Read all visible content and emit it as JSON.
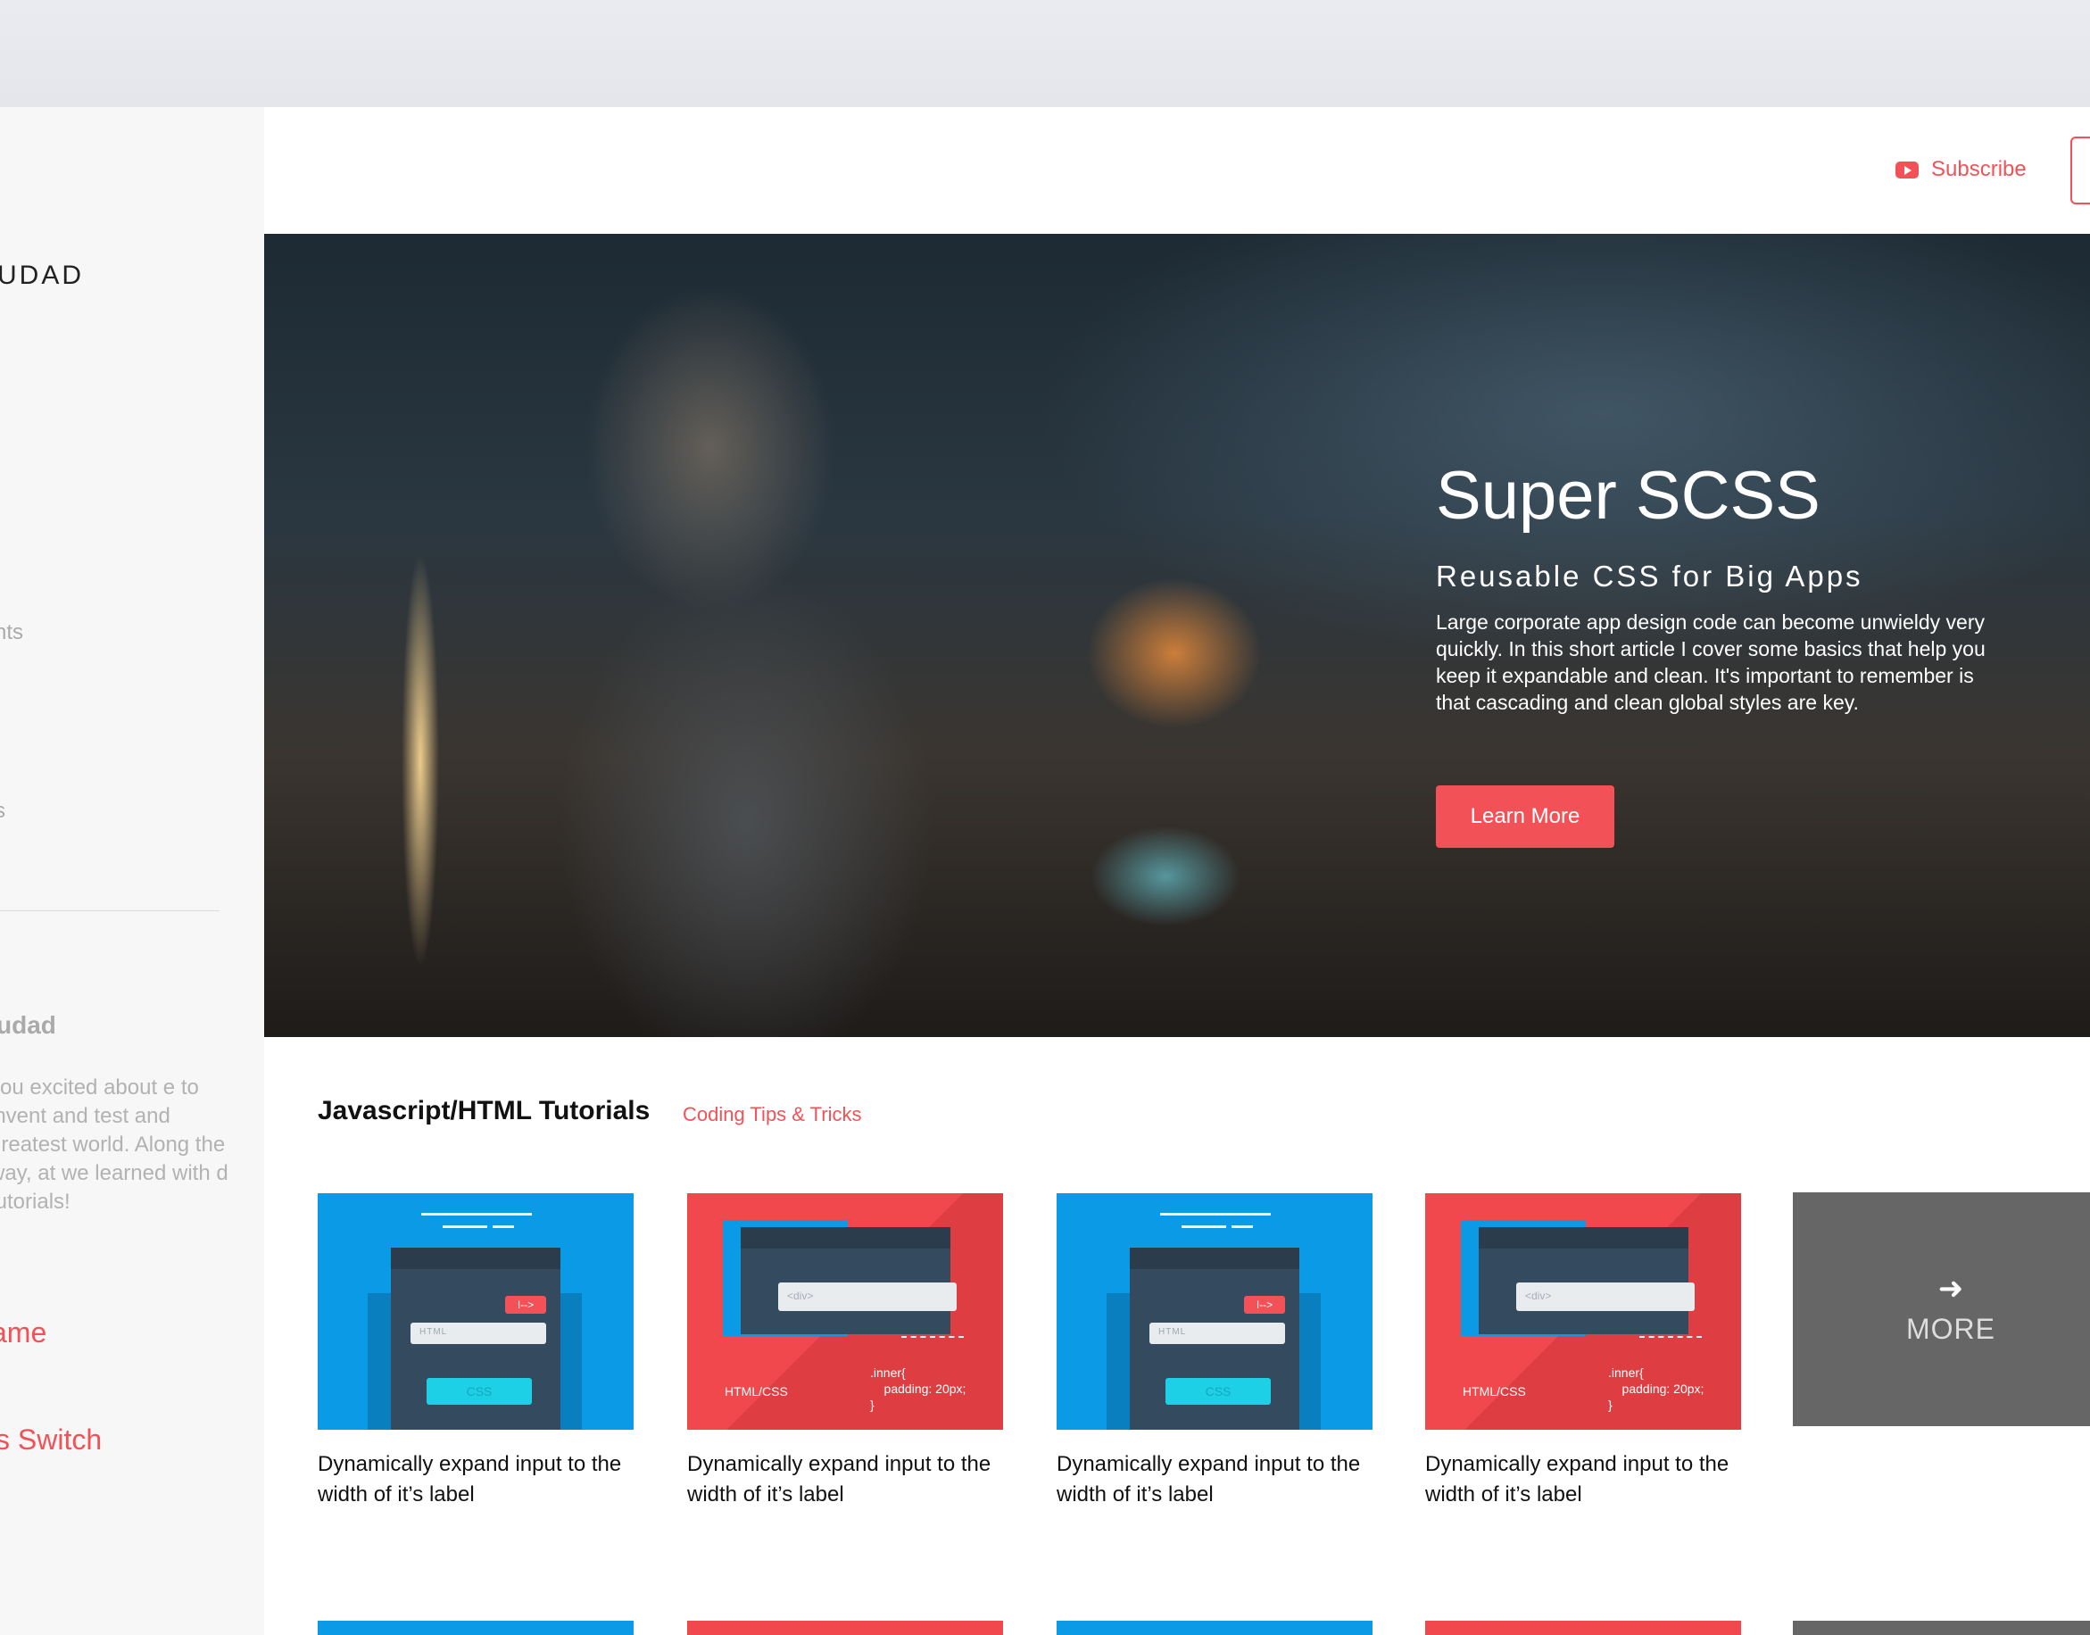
{
  "sidebar": {
    "brand": "UDAD",
    "nav_a": "nts",
    "nav_b": "s",
    "about_title": "udad",
    "about_text": "you excited about e to invent and test and greatest world. Along the way, at we learned with d tutorials!",
    "link_a": "ame",
    "link_b": "s Switch"
  },
  "header": {
    "subscribe_label": "Subscribe",
    "icon": "youtube-icon"
  },
  "hero": {
    "title": "Super SCSS",
    "subtitle": "Reusable CSS for Big Apps",
    "description": "Large corporate app design code can become unwieldy very quickly. In this short article I cover some basics that help you keep it expandable and clean. It's important to remember is that cascading and clean global styles are key.",
    "cta_label": "Learn More"
  },
  "section": {
    "title": "Javascript/HTML Tutorials",
    "link": "Coding Tips & Tricks"
  },
  "cards": [
    {
      "style": "blue",
      "title": "Dynamically expand input to the width of it’s label",
      "tag": "I-->",
      "input_label": "HTML",
      "cta": "CSS"
    },
    {
      "style": "red",
      "title": "Dynamically expand input to the width of it’s label",
      "input_label": "<div>",
      "caption": "HTML/CSS",
      "code": ".inner{\n    padding: 20px;\n}"
    },
    {
      "style": "blue",
      "title": "Dynamically expand input to the width of it’s label",
      "tag": "I-->",
      "input_label": "HTML",
      "cta": "CSS"
    },
    {
      "style": "red",
      "title": "Dynamically expand input to the width of it’s label",
      "input_label": "<div>",
      "caption": "HTML/CSS",
      "code": ".inner{\n    padding: 20px;\n}"
    }
  ],
  "more": {
    "label": "MORE",
    "icon": "arrow-right-icon"
  },
  "colors": {
    "accent": "#f25257",
    "blue": "#0a9ae6",
    "more_bg": "#666666"
  }
}
